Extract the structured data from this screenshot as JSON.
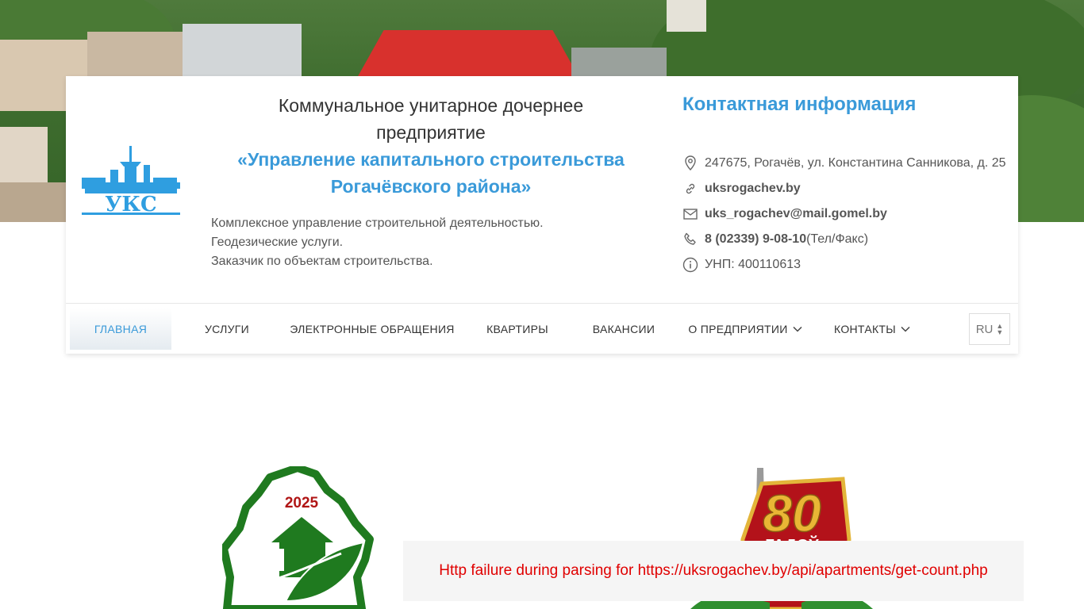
{
  "header": {
    "company_line1": "Коммунальное унитарное дочернее",
    "company_line2": "предприятие",
    "company_line3": "«Управление капитального строительства",
    "company_line4": "Рогачёвского района»",
    "services": [
      "Комплексное управление строительной деятельностью.",
      "Геодезические услуги.",
      "Заказчик по объектам строительства."
    ],
    "logo_text": "УКС"
  },
  "contacts": {
    "title": "Контактная информация",
    "address": "247675, Рогачёв, ул. Константина Санникова, д. 25",
    "website": "uksrogachev.by",
    "email": "uks_rogachev@mail.gomel.by",
    "phone": "8 (02339) 9-08-10",
    "phone_note": " (Тел/Факс)",
    "unp": "УНП: 400110613"
  },
  "nav": {
    "items": [
      {
        "label": "ГЛАВНАЯ"
      },
      {
        "label": "УСЛУГИ"
      },
      {
        "label": "ЭЛЕКТРОННЫЕ ОБРАЩЕНИЯ"
      },
      {
        "label": "КВАРТИРЫ"
      },
      {
        "label": "ВАКАНСИИ"
      },
      {
        "label": "О ПРЕДПРИЯТИИ"
      },
      {
        "label": "КОНТАКТЫ"
      }
    ],
    "lang": "RU"
  },
  "badges": {
    "left_year": "2025",
    "right_number": "80",
    "right_text": "ГАДОЎ"
  },
  "error": {
    "message": "Http failure during parsing for https://uksrogachev.by/api/apartments/get-count.php"
  },
  "colors": {
    "accent": "#3a9ad9",
    "error": "#e00000",
    "logo": "#2f9ee0"
  }
}
